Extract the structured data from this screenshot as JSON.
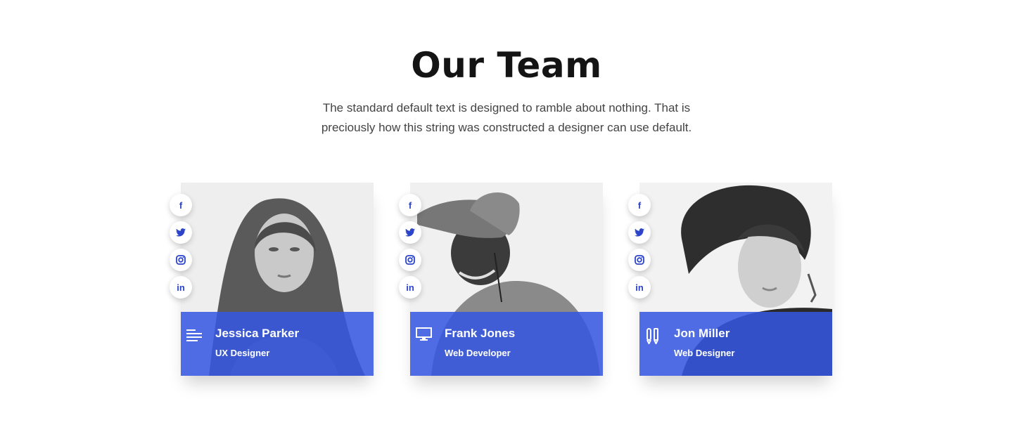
{
  "section": {
    "title": "Our Team",
    "intro": "The standard default text is designed to ramble about nothing. That is preciously how this string was constructed a designer can use default."
  },
  "colors": {
    "accent": "#3456e2",
    "social_icon": "#2b44c9",
    "heading": "#141414",
    "body_text": "#444444"
  },
  "social_icons": [
    "facebook-icon",
    "twitter-icon",
    "instagram-icon",
    "linkedin-icon"
  ],
  "social_glyphs": {
    "facebook": "f",
    "linkedin": "in"
  },
  "team": [
    {
      "name": "Jessica Parker",
      "role": "UX Designer",
      "role_icon": "text-lines-icon"
    },
    {
      "name": "Frank Jones",
      "role": "Web Developer",
      "role_icon": "monitor-icon"
    },
    {
      "name": "Jon Miller",
      "role": "Web Designer",
      "role_icon": "pen-tools-icon"
    }
  ]
}
